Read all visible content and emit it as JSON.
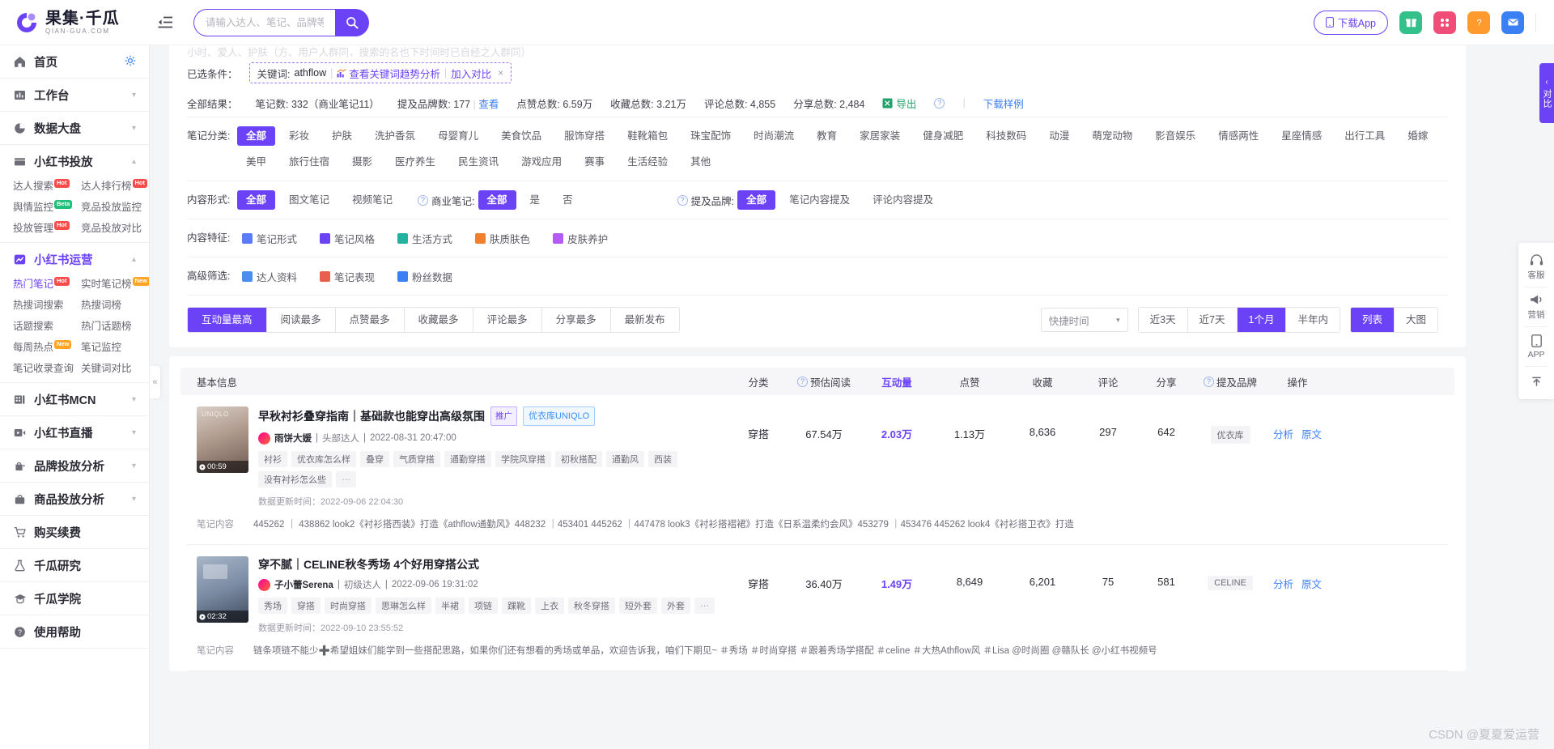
{
  "brand": {
    "name_cn": "果集·千瓜",
    "name_en": "QIAN-GUA.COM"
  },
  "topbar": {
    "search_placeholder": "请输入达人、笔记、品牌等搜索",
    "search_value": "",
    "download_app": "下载App",
    "icons": {
      "collapse": "collapse-menu-icon",
      "search": "search-icon",
      "phone": "phone-icon",
      "gift": "gift-icon",
      "apps": "apps-grid-icon",
      "help": "help-question-icon",
      "mail": "mail-icon"
    }
  },
  "sidebar": {
    "groups": [
      {
        "label": "首页",
        "icon": "home-icon",
        "gear": true,
        "subs": []
      },
      {
        "label": "工作台",
        "icon": "workbench-icon",
        "chevron": true,
        "subs": []
      },
      {
        "label": "数据大盘",
        "icon": "pie-chart-icon",
        "chevron": true,
        "subs": []
      },
      {
        "label": "小红书投放",
        "icon": "folder-icon",
        "chevron": true,
        "expanded": true,
        "subs": [
          {
            "label": "达人搜索",
            "tag": "Hot"
          },
          {
            "label": "达人排行榜",
            "tag": "Hot"
          },
          {
            "label": "舆情监控",
            "tag": "Beta"
          },
          {
            "label": "竞品投放监控"
          },
          {
            "label": "投放管理",
            "tag": "Hot"
          },
          {
            "label": "竞品投放对比"
          }
        ]
      },
      {
        "label": "小红书运营",
        "icon": "trend-icon",
        "chevron": true,
        "expanded": true,
        "active": true,
        "subs": [
          {
            "label": "热门笔记",
            "tag": "Hot",
            "on": true
          },
          {
            "label": "实时笔记榜",
            "tag": "New"
          },
          {
            "label": "热搜词搜索"
          },
          {
            "label": "热搜词榜"
          },
          {
            "label": "话题搜索"
          },
          {
            "label": "热门话题榜"
          },
          {
            "label": "每周热点",
            "tag": "New"
          },
          {
            "label": "笔记监控"
          },
          {
            "label": "笔记收录查询"
          },
          {
            "label": "关键词对比"
          }
        ]
      },
      {
        "label": "小红书MCN",
        "icon": "mcn-icon",
        "chevron": true,
        "subs": []
      },
      {
        "label": "小红书直播",
        "icon": "video-play-icon",
        "chevron": true,
        "subs": []
      },
      {
        "label": "品牌投放分析",
        "icon": "brand-icon",
        "chevron": true,
        "subs": []
      },
      {
        "label": "商品投放分析",
        "icon": "bag-icon",
        "chevron": true,
        "subs": []
      },
      {
        "label": "购买续费",
        "icon": "cart-icon",
        "subs": []
      },
      {
        "label": "千瓜研究",
        "icon": "flask-icon",
        "subs": []
      },
      {
        "label": "千瓜学院",
        "icon": "graduation-icon",
        "subs": []
      },
      {
        "label": "使用帮助",
        "icon": "help-circle-icon",
        "subs": []
      }
    ]
  },
  "filters": {
    "faded_tip": "小时、爱人、护肤（方、用户人群同，搜索的名也下时间时已自经之人群同）",
    "selected_label": "已选条件：",
    "chip": {
      "keyword_prefix": "关键词: ",
      "keyword": "athflow",
      "trend_link": "查看关键词趋势分析",
      "compare_link": "加入对比",
      "close": "×"
    },
    "stats_label": "全部结果：",
    "stats": [
      {
        "label": "笔记数: ",
        "value": "332（商业笔记11）"
      },
      {
        "label": "提及品牌数: ",
        "value": "177",
        "link": "查看"
      },
      {
        "label": "点赞总数: ",
        "value": "6.59万"
      },
      {
        "label": "收藏总数: ",
        "value": "3.21万"
      },
      {
        "label": "评论总数: ",
        "value": "4,855"
      },
      {
        "label": "分享总数: ",
        "value": "2,484"
      }
    ],
    "export_label": "导出",
    "sample_link": "下载样例",
    "rows": [
      {
        "label": "笔记分类:",
        "chips": [
          "全部",
          "彩妆",
          "护肤",
          "洗护香氛",
          "母婴育儿",
          "美食饮品",
          "服饰穿搭",
          "鞋靴箱包",
          "珠宝配饰",
          "时尚潮流",
          "教育",
          "家居家装",
          "健身减肥",
          "科技数码",
          "动漫",
          "萌宠动物",
          "影音娱乐",
          "情感两性",
          "星座情感",
          "出行工具",
          "婚嫁",
          "美甲",
          "旅行住宿",
          "摄影",
          "医疗养生",
          "民生资讯",
          "游戏应用",
          "赛事",
          "生活经验",
          "其他"
        ],
        "selected": "全部"
      }
    ],
    "content_form": {
      "label": "内容形式:",
      "chips": [
        "全部",
        "图文笔记",
        "视频笔记"
      ],
      "selected": "全部"
    },
    "commercial": {
      "label": "商业笔记:",
      "chips": [
        "全部",
        "是",
        "否"
      ],
      "selected": "全部"
    },
    "mention_brand": {
      "label": "提及品牌:",
      "chips": [
        "全部",
        "笔记内容提及",
        "评论内容提及"
      ],
      "selected": "全部"
    },
    "content_feature": {
      "label": "内容特征:",
      "items": [
        {
          "label": "笔记形式",
          "color": "#5b7cfa"
        },
        {
          "label": "笔记风格",
          "color": "#6b42f5"
        },
        {
          "label": "生活方式",
          "color": "#22b3a0"
        },
        {
          "label": "肤质肤色",
          "color": "#f0802e"
        },
        {
          "label": "皮肤养护",
          "color": "#b45bf5"
        }
      ]
    },
    "advanced": {
      "label": "高级筛选:",
      "items": [
        {
          "label": "达人资料",
          "color": "#4a8ef0"
        },
        {
          "label": "笔记表现",
          "color": "#e8604c"
        },
        {
          "label": "粉丝数据",
          "color": "#3b7ff5"
        }
      ]
    }
  },
  "sortbar": {
    "tabs": [
      "互动量最高",
      "阅读最多",
      "点赞最多",
      "收藏最多",
      "评论最多",
      "分享最多",
      "最新发布"
    ],
    "active": "互动量最高",
    "quick_time": "快捷时间",
    "ranges": [
      "近3天",
      "近7天",
      "1个月",
      "半年内"
    ],
    "range_active": "1个月",
    "views": [
      "列表",
      "大图"
    ],
    "view_active": "列表"
  },
  "table": {
    "headers": {
      "basic": "基本信息",
      "category": "分类",
      "est_read": "预估阅读",
      "interaction": "互动量",
      "likes": "点赞",
      "favorites": "收藏",
      "comments": "评论",
      "shares": "分享",
      "brand": "提及品牌",
      "action": "操作"
    },
    "note_label": "笔记内容",
    "rows": [
      {
        "thumb_class": "t1",
        "duration": "00:59",
        "title": "早秋衬衫叠穿指南｜基础款也能穿出高级氛围",
        "promo": "推广",
        "brand_badge": "优衣库UNIQLO",
        "author": "雨饼大媛",
        "author_level": "头部达人",
        "published": "2022-08-31 20:47:00",
        "tags": [
          "衬衫",
          "优衣库怎么样",
          "叠穿",
          "气质穿搭",
          "通勤穿搭",
          "学院风穿搭",
          "初秋搭配",
          "通勤风",
          "西装",
          "没有衬衫怎么些",
          "…"
        ],
        "updated": "数据更新时间：2022-09-06 22:04:30",
        "category": "穿搭",
        "est_read": "67.54万",
        "interaction": "2.03万",
        "likes": "1.13万",
        "favorites": "8,636",
        "comments": "297",
        "shares": "642",
        "brand": "优衣库",
        "actions": [
          "分析",
          "原文"
        ],
        "note": "445262 ｜ 438862 look2《衬衫搭西装》打造《athflow通勤风》448232 ｜453401 445262 ｜447478 look3《衬衫搭褶裙》打造《日系温柔约会风》453279 ｜453476 445262 look4《衬衫搭卫衣》打造"
      },
      {
        "thumb_class": "t2",
        "duration": "02:32",
        "title": "穿不腻｜CELINE秋冬秀场 4个好用穿搭公式",
        "promo": "",
        "brand_badge": "",
        "author": "子小蕾Serena",
        "author_level": "初级达人",
        "published": "2022-09-06 19:31:02",
        "tags": [
          "秀场",
          "穿搭",
          "时尚穿搭",
          "思琳怎么样",
          "半裙",
          "项链",
          "踝靴",
          "上衣",
          "秋冬穿搭",
          "短外套",
          "外套",
          "…"
        ],
        "updated": "数据更新时间：2022-09-10 23:55:52",
        "category": "穿搭",
        "est_read": "36.40万",
        "interaction": "1.49万",
        "likes": "8,649",
        "favorites": "6,201",
        "comments": "75",
        "shares": "581",
        "brand": "CELINE",
        "actions": [
          "分析",
          "原文"
        ],
        "note": "链条项链不能少➕希望姐妹们能学到一些搭配思路，如果你们还有想看的秀场或单品，欢迎告诉我，咱们下期见~ ＃秀场 ＃时尚穿搭 ＃跟着秀场学搭配 ＃celine ＃大热Athflow风 ＃Lisa @时尚圈 @赣队长 @小红书视频号"
      }
    ]
  },
  "right_rail": {
    "compare_tab": "对比",
    "items": [
      {
        "label": "客服",
        "icon": "headset-icon"
      },
      {
        "label": "营销",
        "icon": "megaphone-icon"
      },
      {
        "label": "APP",
        "icon": "mobile-icon"
      }
    ],
    "back_to_top": "back-to-top-icon"
  },
  "watermark": "CSDN @夏夏爱运营",
  "colors": {
    "accent": "#6b42f5",
    "link": "#3b7ff5",
    "green": "#22a06b",
    "hot": "#fa4b4b"
  }
}
